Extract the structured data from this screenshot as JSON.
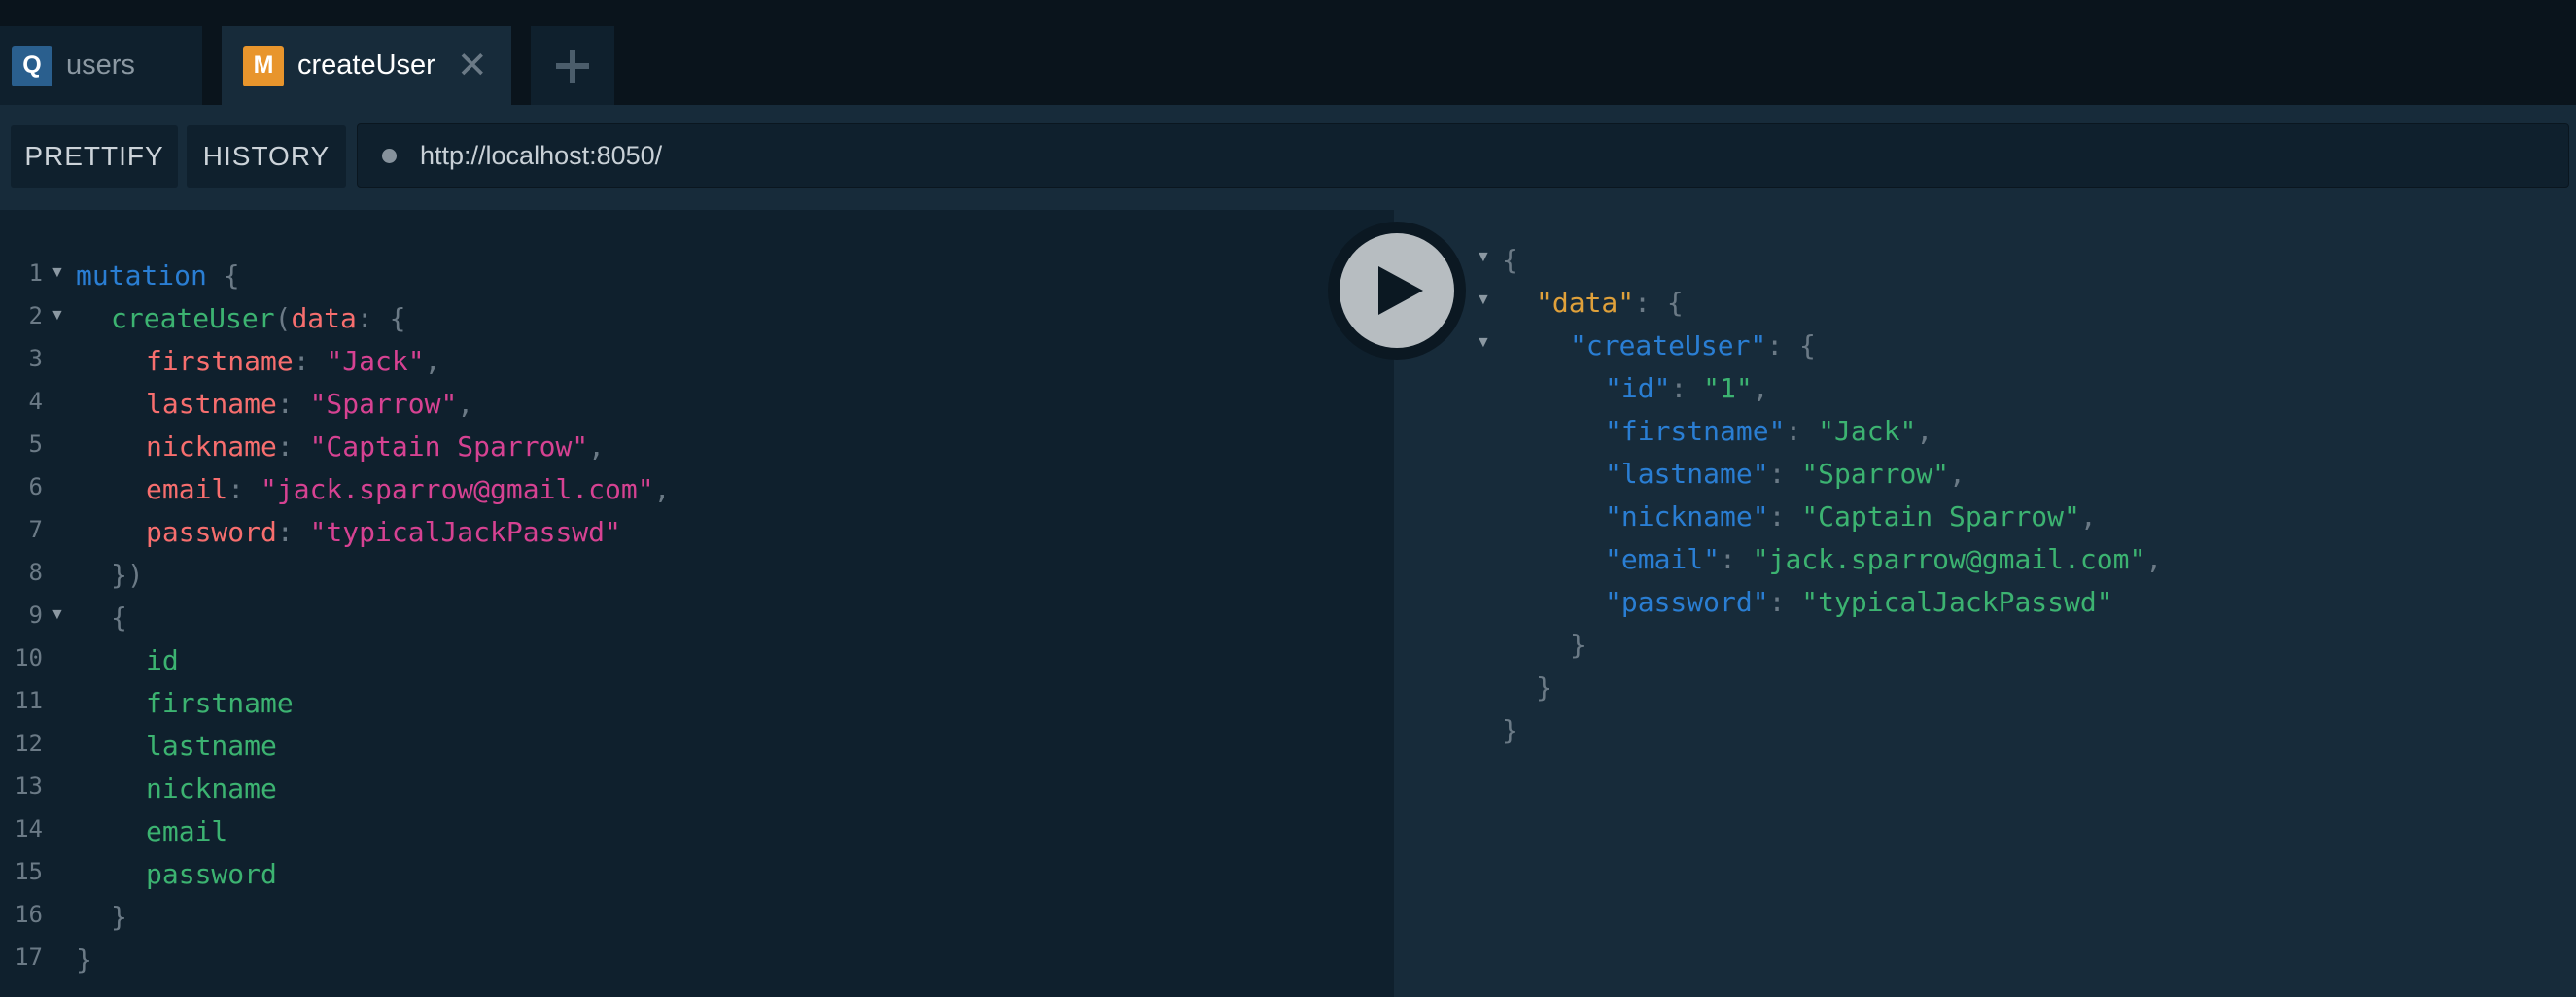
{
  "tabs": [
    {
      "badge": "Q",
      "badge_color": "#2a5f8e",
      "title": "users",
      "active": false
    },
    {
      "badge": "M",
      "badge_color": "#e8952c",
      "title": "createUser",
      "active": true,
      "close": "✕"
    }
  ],
  "add_tab_icon": "plus-icon",
  "toolbar": {
    "prettify_label": "PRETTIFY",
    "history_label": "HISTORY",
    "endpoint": "http://localhost:8050/"
  },
  "execute_icon": "play-icon",
  "line_numbers": [
    "1",
    "2",
    "3",
    "4",
    "5",
    "6",
    "7",
    "8",
    "9",
    "10",
    "11",
    "12",
    "13",
    "14",
    "15",
    "16",
    "17"
  ],
  "query": {
    "l1": {
      "kw": "mutation",
      "brace": "{"
    },
    "l2": {
      "field": "createUser",
      "paren": "(",
      "arg": "data",
      "colon": ":",
      "brace": "{"
    },
    "l3": {
      "arg": "firstname",
      "colon": ":",
      "value": "\"Jack\"",
      "comma": ","
    },
    "l4": {
      "arg": "lastname",
      "colon": ":",
      "value": "\"Sparrow\"",
      "comma": ","
    },
    "l5": {
      "arg": "nickname",
      "colon": ":",
      "value": "\"Captain Sparrow\"",
      "comma": ","
    },
    "l6": {
      "arg": "email",
      "colon": ":",
      "value": "\"jack.sparrow@gmail.com\"",
      "comma": ","
    },
    "l7": {
      "arg": "password",
      "colon": ":",
      "value": "\"typicalJackPasswd\""
    },
    "l8": "})",
    "l9": "{",
    "l10": "id",
    "l11": "firstname",
    "l12": "lastname",
    "l13": "nickname",
    "l14": "email",
    "l15": "password",
    "l16": "}",
    "l17": "}"
  },
  "result": {
    "open": "{",
    "data_key": "\"data\"",
    "create_key": "\"createUser\"",
    "colon": ":",
    "brace": "{",
    "fields": [
      {
        "key": "\"id\"",
        "value": "\"1\"",
        "comma": ","
      },
      {
        "key": "\"firstname\"",
        "value": "\"Jack\"",
        "comma": ","
      },
      {
        "key": "\"lastname\"",
        "value": "\"Sparrow\"",
        "comma": ","
      },
      {
        "key": "\"nickname\"",
        "value": "\"Captain Sparrow\"",
        "comma": ","
      },
      {
        "key": "\"email\"",
        "value": "\"jack.sparrow@gmail.com\"",
        "comma": ","
      },
      {
        "key": "\"password\"",
        "value": "\"typicalJackPasswd\"",
        "comma": ""
      }
    ],
    "close": "}"
  }
}
